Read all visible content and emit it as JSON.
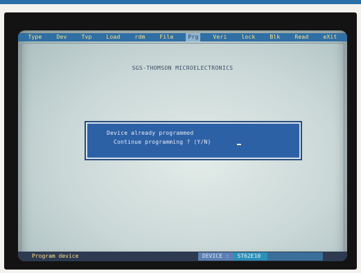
{
  "menubar": {
    "items": [
      {
        "label": "Type",
        "active": false
      },
      {
        "label": "Dev",
        "active": false
      },
      {
        "label": "Tvp",
        "active": false
      },
      {
        "label": "Load",
        "active": false
      },
      {
        "label": "rdm",
        "active": false
      },
      {
        "label": "File",
        "active": false
      },
      {
        "label": "Prg",
        "active": true
      },
      {
        "label": "Veri",
        "active": false
      },
      {
        "label": "lock",
        "active": false
      },
      {
        "label": "Blk",
        "active": false
      },
      {
        "label": "Read",
        "active": false
      },
      {
        "label": "eXit",
        "active": false
      }
    ]
  },
  "header": {
    "title": "SGS-THOMSON MICROELECTRONICS"
  },
  "dialog": {
    "line1": "Device already programmed",
    "line2": "Continue programming ? (Y/N)"
  },
  "statusbar": {
    "left_text": "Program device",
    "device_label": "DEVICE :",
    "device_value": "ST62E10"
  },
  "colors": {
    "menubar_bg": "#2f6fa3",
    "menu_text": "#ffe08a",
    "dialog_bg": "#2d61a6",
    "screen_bg": "#c9d7d6"
  }
}
